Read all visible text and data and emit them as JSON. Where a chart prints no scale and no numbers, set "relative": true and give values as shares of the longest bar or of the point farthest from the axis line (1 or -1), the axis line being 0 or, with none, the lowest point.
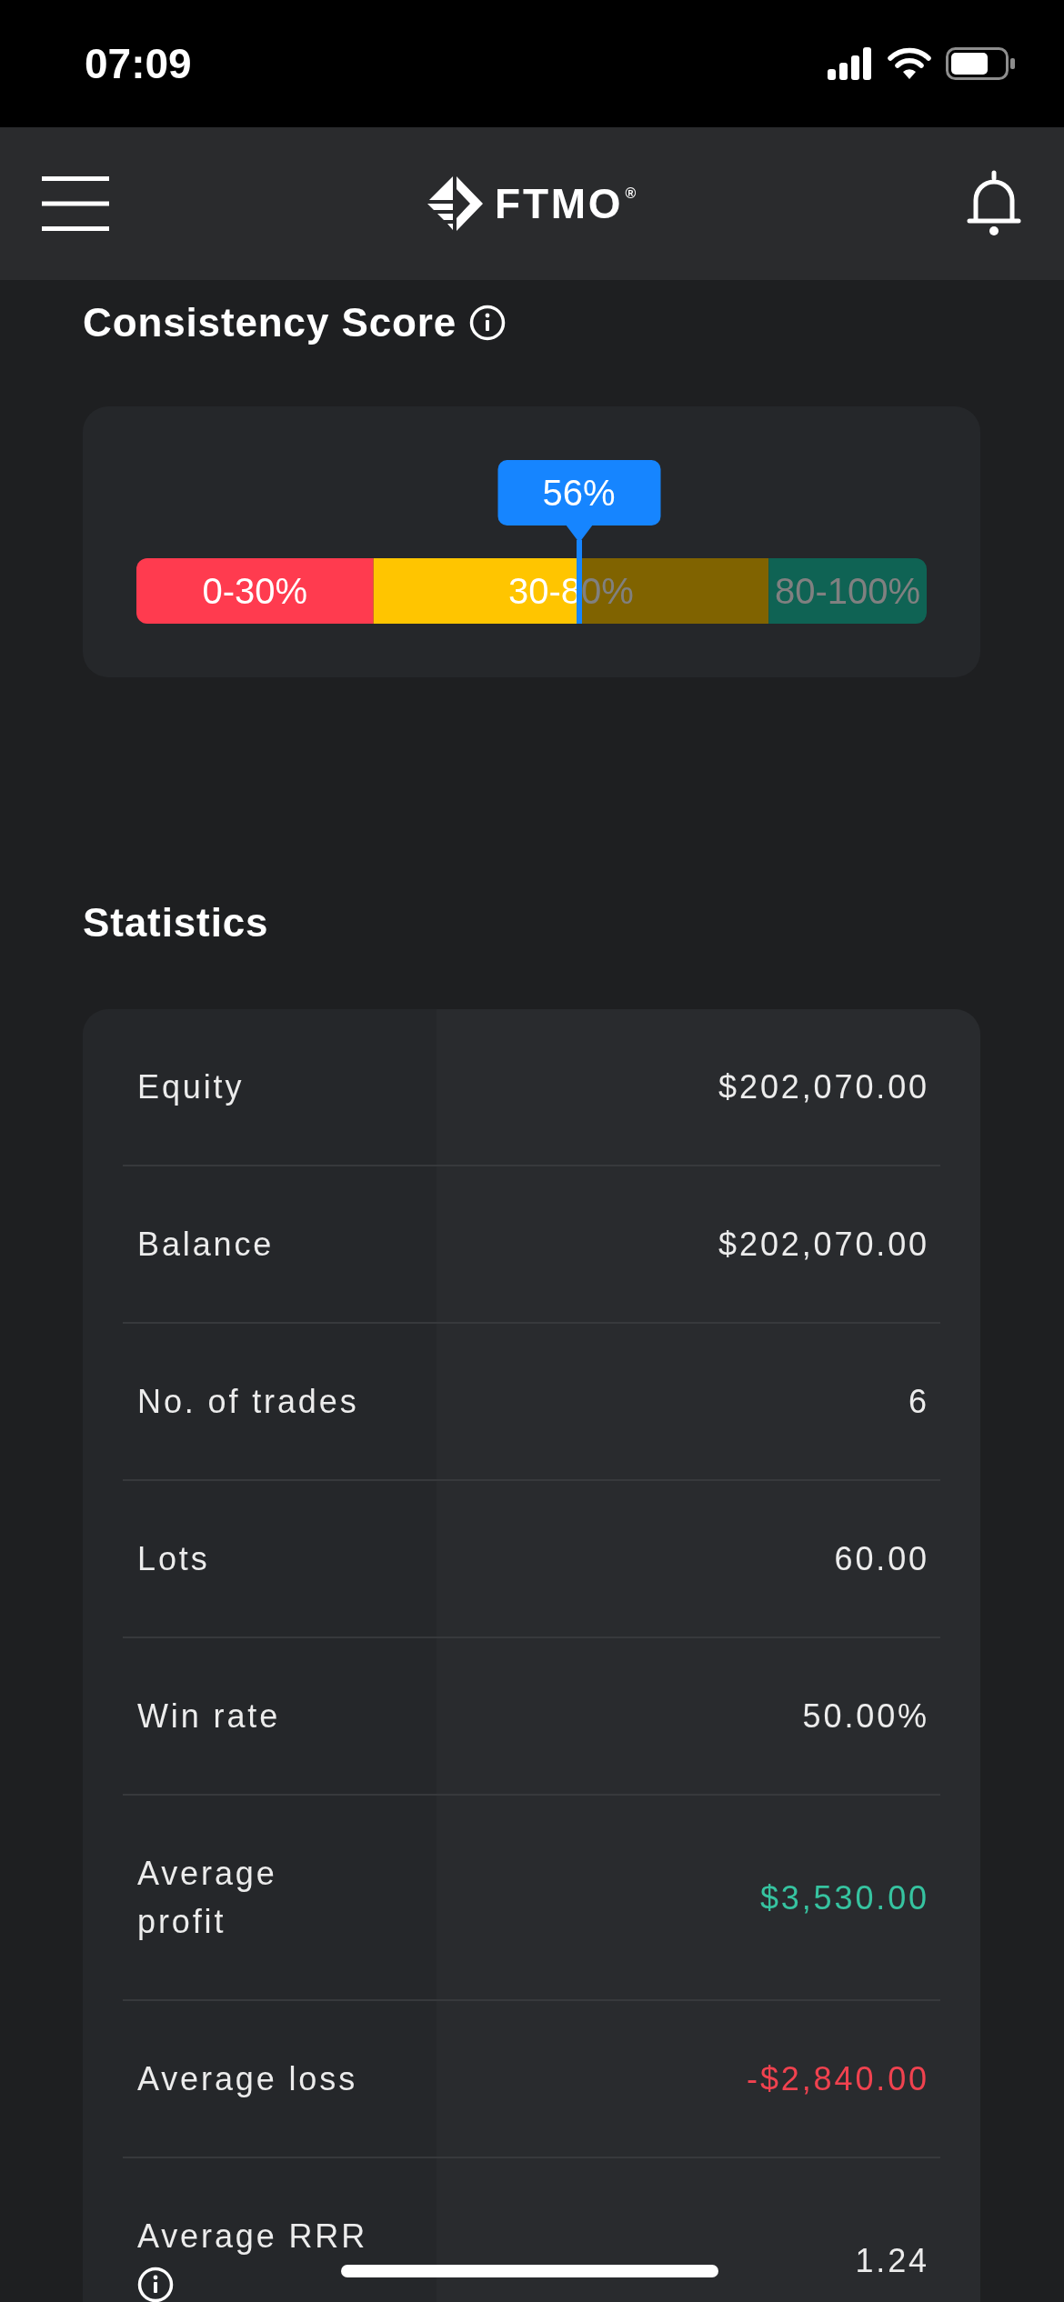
{
  "status_bar": {
    "time": "07:09"
  },
  "header": {
    "logo_text": "FTMO$^{®}$"
  },
  "consistency_score": {
    "title": "Consistency Score",
    "score": {
      "label": "56%",
      "level": 0.56
    },
    "chart_data": {
      "type": "bar",
      "orientation": "horizontal",
      "stacked": true,
      "relative": true,
      "series": [
        {
          "name": "0-30%",
          "color": "#ff3b4f",
          "values": [
            0.3
          ]
        },
        {
          "name": "30-80%",
          "color": "#ffc500",
          "values": [
            0.5
          ]
        },
        {
          "name": "80-100%",
          "color": "#0f6354",
          "values": [
            0.2
          ]
        }
      ]
    }
  },
  "statistics": {
    "title": "Statistics",
    "rows": [
      {
        "label": "Equity",
        "value": "$202,070.00",
        "kind": "plain",
        "info": false
      },
      {
        "label": "Balance",
        "value": "$202,070.00",
        "kind": "plain",
        "info": false
      },
      {
        "label": "No. of trades",
        "value": "6",
        "kind": "plain",
        "info": false
      },
      {
        "label": "Lots",
        "value": "60.00",
        "kind": "plain",
        "info": false
      },
      {
        "label": "Win rate",
        "value": "50.00%",
        "kind": "plain",
        "info": false
      },
      {
        "label": "Average profit",
        "value": "$3,530.00",
        "kind": "profit",
        "info": false
      },
      {
        "label": "Average loss",
        "value": "-$2,840.00",
        "kind": "loss",
        "info": false
      },
      {
        "label": "Average RRR",
        "value": "1.24",
        "kind": "plain",
        "info": true
      }
    ]
  }
}
